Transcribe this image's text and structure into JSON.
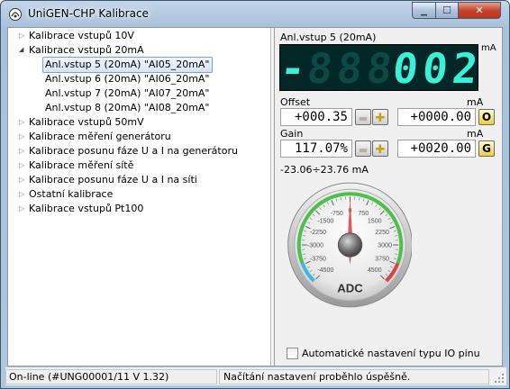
{
  "window": {
    "title": "UniGEN-CHP Kalibrace",
    "min_glyph": "▁",
    "max_glyph": "☐",
    "close_glyph": "✕"
  },
  "tree": {
    "items": [
      {
        "label": "Kalibrace vstupů 10V",
        "expanded": false
      },
      {
        "label": "Kalibrace vstupů 20mA",
        "expanded": true
      },
      {
        "label": "Anl.vstup 5 (20mA)  \"AI05_20mA\"",
        "child": true,
        "selected": true
      },
      {
        "label": "Anl.vstup 6 (20mA)  \"AI06_20mA\"",
        "child": true
      },
      {
        "label": "Anl.vstup 7 (20mA)  \"AI07_20mA\"",
        "child": true
      },
      {
        "label": "Anl.vstup 8 (20mA)  \"AI08_20mA\"",
        "child": true
      },
      {
        "label": "Kalibrace vstupů 50mV",
        "expanded": false
      },
      {
        "label": "Kalibrace měření generátoru",
        "expanded": false
      },
      {
        "label": "Kalibrace posunu fáze U a I na generátoru",
        "expanded": false
      },
      {
        "label": "Kalibrace měření sítě",
        "expanded": false
      },
      {
        "label": "Kalibrace posunu fáze U a I na síti",
        "expanded": false
      },
      {
        "label": "Ostatní kalibrace",
        "expanded": false
      },
      {
        "label": "Kalibrace vstupů Pt100",
        "expanded": false
      }
    ]
  },
  "panel": {
    "channel_title": "Anl.vstup 5 (20mA)",
    "display": {
      "digits": [
        "-",
        "8",
        "8",
        "8",
        "0",
        "0",
        "2"
      ],
      "unit": "mA",
      "value": "-0.02",
      "dim_color": "#0b4a44",
      "lit_color": "#3af0d8"
    },
    "offset": {
      "label": "Offset",
      "unit": "mA",
      "value": "+000.35",
      "raw": "+0000.00",
      "btn": "O"
    },
    "gain": {
      "label": "Gain",
      "unit": "mA",
      "value": "117.07%",
      "raw": "+0020.00",
      "btn": "G"
    },
    "minus_glyph": "▬",
    "plus_glyph": "✚",
    "range": "-23.06÷23.76 mA",
    "gauge": {
      "label": "ADC",
      "ticks": [
        "-4500",
        "-3750",
        "-3000",
        "-2250",
        "-1500",
        "-750",
        "0",
        "750",
        "1500",
        "2250",
        "3000",
        "3750",
        "4500"
      ],
      "value": 0,
      "min": -4500,
      "max": 4500
    },
    "auto_checkbox": {
      "label": "Automatické nastavení typu IO pinu",
      "checked": false
    }
  },
  "status": {
    "left": "On-line (#UNG00001/11  V 1.32)",
    "right": "Načítání nastavení proběhlo úspěšně."
  }
}
